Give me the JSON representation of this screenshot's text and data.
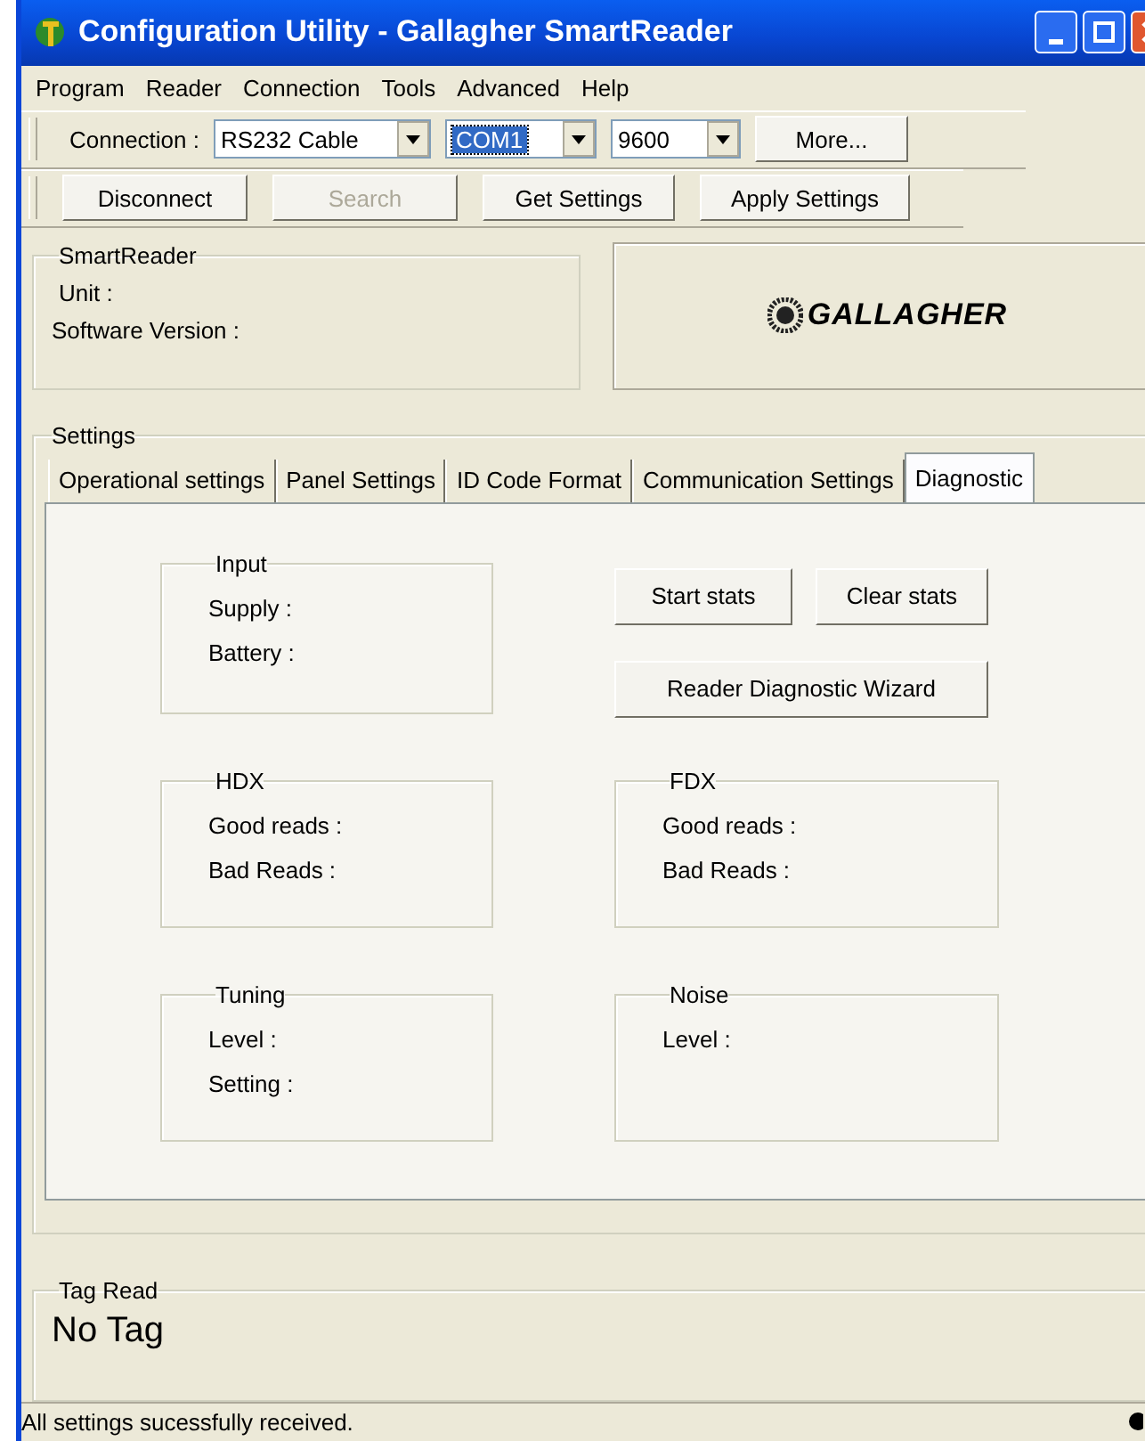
{
  "window": {
    "title": "Configuration Utility - Gallagher SmartReader"
  },
  "menu": [
    "Program",
    "Reader",
    "Connection",
    "Tools",
    "Advanced",
    "Help"
  ],
  "toolbar": {
    "connection_label": "Connection :",
    "connection": "RS232 Cable",
    "port": "COM1",
    "baud": "9600",
    "more": "More..."
  },
  "actions": [
    {
      "label": "Disconnect",
      "disabled": false
    },
    {
      "label": "Search",
      "disabled": true
    },
    {
      "label": "Get Settings",
      "disabled": false
    },
    {
      "label": "Apply Settings",
      "disabled": false
    }
  ],
  "smartreader": {
    "title": "SmartReader",
    "fields": [
      "Unit :",
      "Software Version :"
    ]
  },
  "logo": "GALLAGHER",
  "settings": {
    "title": "Settings",
    "tabs": [
      {
        "label": "Operational settings",
        "selected": false
      },
      {
        "label": "Panel Settings",
        "selected": false
      },
      {
        "label": "ID Code Format",
        "selected": false
      },
      {
        "label": "Communication Settings",
        "selected": false
      },
      {
        "label": "Diagnostic",
        "selected": true
      }
    ],
    "groups": [
      {
        "title": "Input",
        "fields": [
          "Supply :",
          "Battery :"
        ]
      },
      {
        "title": "HDX",
        "fields": [
          "Good reads :",
          "Bad Reads :"
        ]
      },
      {
        "title": "FDX",
        "fields": [
          "Good reads :",
          "Bad Reads :"
        ]
      },
      {
        "title": "Tuning",
        "fields": [
          "Level :",
          "Setting :"
        ]
      },
      {
        "title": "Noise",
        "fields": [
          "Level :"
        ]
      }
    ],
    "buttons": [
      "Start stats",
      "Clear stats",
      "Reader Diagnostic Wizard"
    ]
  },
  "tag_read": {
    "title": "Tag Read",
    "value": "No Tag"
  },
  "status_bar": "All settings sucessfully received."
}
